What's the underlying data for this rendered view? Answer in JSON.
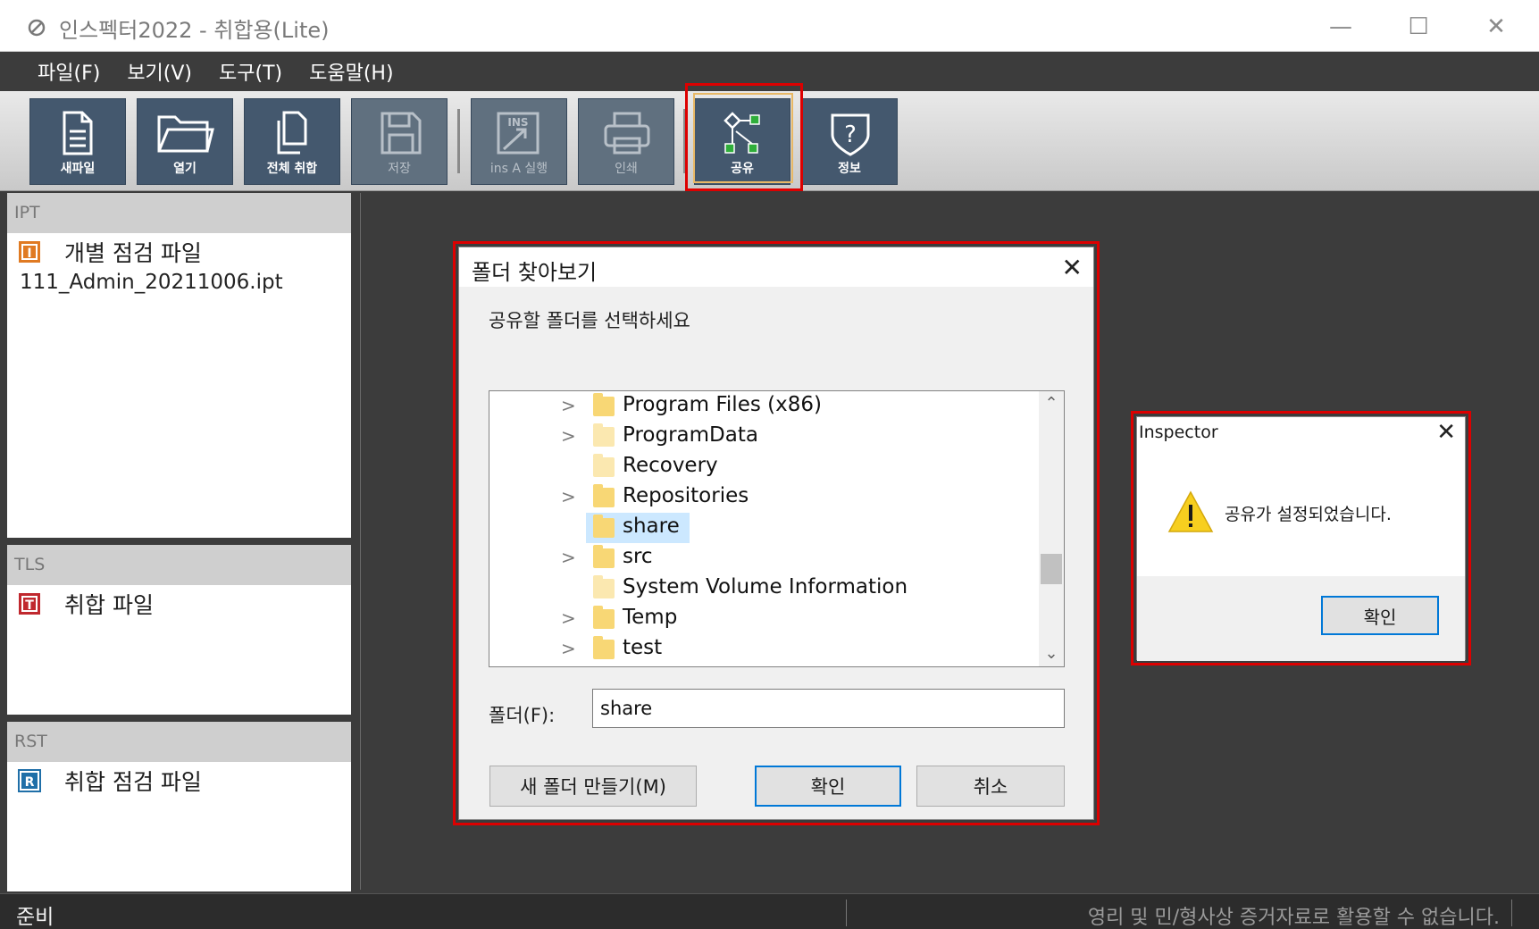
{
  "app": {
    "title": "인스펙터2022 - 취합용(Lite)"
  },
  "window_controls": {
    "minimize": "—",
    "maximize": "☐",
    "close": "✕"
  },
  "menu": [
    "파일(F)",
    "보기(V)",
    "도구(T)",
    "도움말(H)"
  ],
  "toolbar": {
    "buttons": [
      {
        "label": "새파일",
        "icon": "new-file-icon",
        "enabled": true
      },
      {
        "label": "열기",
        "icon": "open-folder-icon",
        "enabled": true
      },
      {
        "label": "전체 취합",
        "icon": "merge-files-icon",
        "enabled": true
      },
      {
        "label": "저장",
        "icon": "save-icon",
        "enabled": false
      },
      {
        "label": "ins A 실행",
        "icon": "ins-run-icon",
        "enabled": false
      },
      {
        "label": "인쇄",
        "icon": "print-icon",
        "enabled": false
      },
      {
        "label": "공유",
        "icon": "share-network-icon",
        "enabled": true
      },
      {
        "label": "정보",
        "icon": "info-shield-icon",
        "enabled": true
      }
    ]
  },
  "panels": {
    "ipt": {
      "header": "IPT",
      "badge": "I",
      "title": "개별 점검 파일",
      "files": [
        "111_Admin_20211006.ipt"
      ]
    },
    "tls": {
      "header": "TLS",
      "badge": "T",
      "title": "취합 파일"
    },
    "rst": {
      "header": "RST",
      "badge": "R",
      "title": "취합 점검 파일"
    }
  },
  "folder_dialog": {
    "title": "폴더 찾아보기",
    "close": "✕",
    "prompt": "공유할 폴더를 선택하세요",
    "tree": [
      {
        "name": "Program Files (x86)",
        "expandable": true,
        "selected": false
      },
      {
        "name": "ProgramData",
        "expandable": true,
        "selected": false
      },
      {
        "name": "Recovery",
        "expandable": false,
        "selected": false
      },
      {
        "name": "Repositories",
        "expandable": true,
        "selected": false
      },
      {
        "name": "share",
        "expandable": false,
        "selected": true
      },
      {
        "name": "src",
        "expandable": true,
        "selected": false
      },
      {
        "name": "System Volume Information",
        "expandable": false,
        "selected": false
      },
      {
        "name": "Temp",
        "expandable": true,
        "selected": false
      },
      {
        "name": "test",
        "expandable": true,
        "selected": false
      }
    ],
    "folder_label": "폴더(F):",
    "folder_value": "share",
    "new_folder_label": "새 폴더 만들기(M)",
    "ok_label": "확인",
    "cancel_label": "취소"
  },
  "message_box": {
    "title": "Inspector",
    "close": "✕",
    "icon": "warning-icon",
    "message": "공유가 설정되었습니다.",
    "ok_label": "확인"
  },
  "status": {
    "left": "준비",
    "right": "영리 및 민/형사상 증거자료로 활용할 수 없습니다."
  },
  "colors": {
    "highlight_frame": "#dd0000",
    "toolbar_button": "#44586e",
    "workspace": "#3c3c3c",
    "selection": "#cce8ff"
  }
}
